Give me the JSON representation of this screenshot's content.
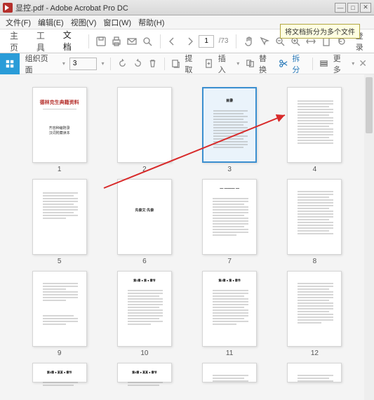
{
  "title": "显控.pdf - Adobe Acrobat Pro DC",
  "menu": {
    "file": "文件(F)",
    "edit": "编辑(E)",
    "view": "视图(V)",
    "window": "窗口(W)",
    "help": "帮助(H)"
  },
  "tabs": {
    "home": "主页",
    "tools": "工具",
    "document": "文档",
    "page_current": "1",
    "login": "登录"
  },
  "toolbar": {
    "organize": "组织页面",
    "page_num": "3",
    "extract": "提取",
    "insert": "插入",
    "replace": "替换",
    "split": "拆分",
    "more": "更多"
  },
  "tooltip": "将文档拆分为多个文件",
  "pages": {
    "p1_title": "德林克生典籍资料",
    "p1_sub1": "齐容种编既录",
    "p1_sub2": "汉词附藏读本",
    "p3_header": "目录",
    "p6_title": "先秦文·先秦",
    "labels": [
      "1",
      "2",
      "3",
      "4",
      "5",
      "6",
      "7",
      "8",
      "9",
      "10",
      "11",
      "12"
    ]
  }
}
